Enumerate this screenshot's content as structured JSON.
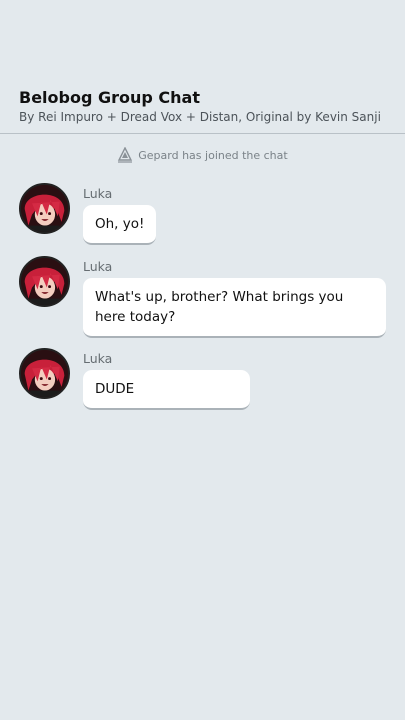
{
  "header": {
    "title": "Belobog Group Chat",
    "subtitle": "By Rei Impuro + Dread Vox + Distan, Original by Kevin Sanji"
  },
  "system_note": {
    "icon": "caravan-crest-icon",
    "text": "Gepard has joined the chat"
  },
  "messages": [
    {
      "sender": "Luka",
      "avatar": "luka-avatar",
      "text": "Oh, yo!"
    },
    {
      "sender": "Luka",
      "avatar": "luka-avatar",
      "text": "What's up, brother? What brings you here today?"
    },
    {
      "sender": "Luka",
      "avatar": "luka-avatar",
      "text": "DUDE"
    }
  ],
  "colors": {
    "background": "#e3e9ed",
    "bubble": "#ffffff",
    "divider": "#b9c1c7"
  }
}
